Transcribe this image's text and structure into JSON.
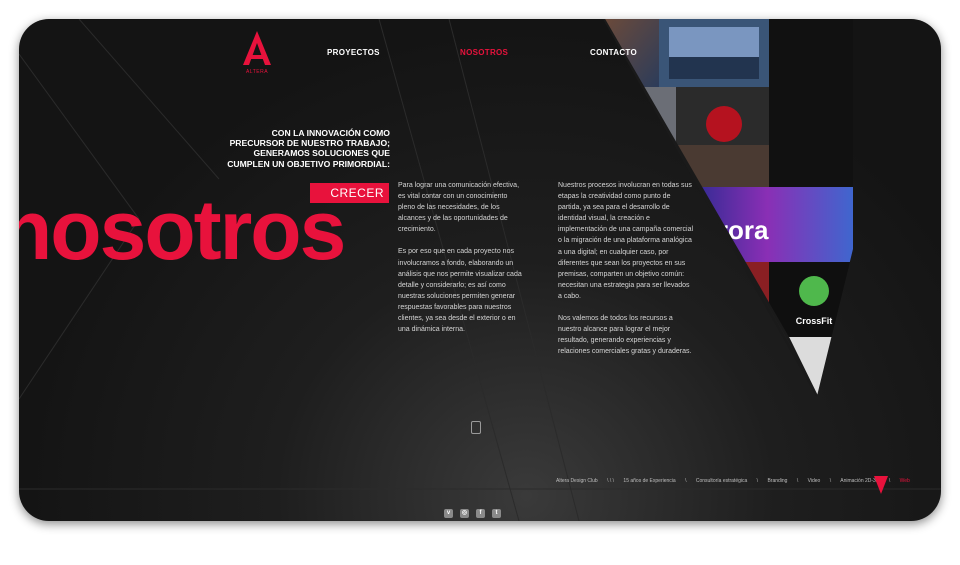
{
  "brand": {
    "name": "ALTERA"
  },
  "nav": {
    "items": [
      {
        "label": "PROYECTOS"
      },
      {
        "label": "NOSOTROS"
      },
      {
        "label": "CONTACTO"
      }
    ]
  },
  "hero": {
    "intro": "CON LA INNOVACIÓN COMO PRECURSOR DE NUESTRO TRABAJO; GENERAMOS SOLUCIONES QUE CUMPLEN UN OBJETIVO PRIMORDIAL:",
    "highlight": "CRECER",
    "title": "nosotros"
  },
  "body": {
    "col1": [
      "Para lograr una comunicación efectiva, es vital contar con un conocimiento pleno de las necesidades, de los alcances y de las oportunidades de crecimiento.",
      "Es por eso que en cada proyecto nos involucramos a fondo, elaborando un análisis que nos permite visualizar cada detalle y considerarlo; es así como nuestras soluciones permiten generar respuestas favorables para nuestros clientes, ya sea desde el exterior o en una dinámica interna."
    ],
    "col2": [
      "Nuestros procesos involucran en todas sus etapas la creatividad como punto de partida, ya sea para el desarrollo de identidad visual, la creación e implementación de una campaña comercial o la migración de una plataforma analógica a una digital; en cualquier caso, por diferentes que sean los proyectos en sus premisas, comparten un objetivo común: necesitan una estrategia para ser llevados a cabo.",
      "Nos valemos de todos los recursos a nuestro alcance para lograr el mejor resultado, generando experiencias y relaciones comerciales gratas y duraderas."
    ]
  },
  "portfolio": {
    "tile_aurora": "urora",
    "tile_crossfit": "CrossFit"
  },
  "footer": {
    "items": [
      "Altera Design Club",
      "\\ \\ \\",
      "15 años de Experiencia",
      "\\",
      "Consultoría estratégica",
      "\\",
      "Branding",
      "\\",
      "Video",
      "\\",
      "Animación 2D-3D",
      "\\",
      "Web"
    ]
  },
  "social": {
    "icons": [
      "vimeo-icon",
      "instagram-icon",
      "facebook-icon",
      "twitter-icon"
    ]
  },
  "colors": {
    "accent": "#e8123c",
    "background": "#141414",
    "text": "#ffffff"
  }
}
